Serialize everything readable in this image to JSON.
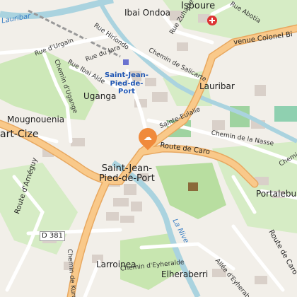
{
  "map": {
    "places": {
      "ibai_ondoa": "Ibai Ondoa",
      "ispoure": "Ispoure",
      "uganga": "Uganga",
      "lauribar": "Lauribar",
      "mougnouenia": "Mougnouenia",
      "art_cize": "art-Cize",
      "saint_jean_big": "Saint-Jean-\nPied-de-Port",
      "saint_jean_blue": "Saint-Jean-\nPied-de-\nPort",
      "larroinea": "Larroinea",
      "elheraberri": "Elheraberri",
      "portaleburu": "Portaleburu",
      "lauribar_top": "Lauribar"
    },
    "roads": {
      "rue_zuharte": "Rue Zuharte",
      "rue_abotia": "Rue Abotia",
      "avenue_colonel": "venue Colonel Bi",
      "rue_hirigoko": "Rue Hiriondo",
      "rue_urgain": "Rue d'Urgain",
      "rue_jara": "Rue du Jara",
      "chemin_salicarte": "Chemin de Salicarte",
      "chemin_ugange": "Chemin d'Ugange",
      "rue_ibai_alde": "Rue Ibai Alde",
      "sainte_eulalie": "Sainte-Eulalie",
      "chemin_nasse": "Chemin de la Nasse",
      "route_caro": "Route de Caro",
      "route_caro_2": "Route de Caro",
      "route_arneguy": "Route d'Arnéguy",
      "d381": "D 381",
      "chemin_eyheralde": "Chemin d'Eyheralde",
      "allee_eyheraberri": "Allée d'Eyheraberri",
      "chemin_kuroa": "Chemin de Kuroa",
      "chemin_ch": "Chemi"
    },
    "rivers": {
      "la_nive": "La Nive",
      "laurhibar": "Laurhibar"
    },
    "marker_icon": "map-pin-icon",
    "colors": {
      "land": "#f2efe9",
      "green": "#c8e6b0",
      "park": "#b8dea0",
      "water": "#aad3df",
      "major_road": "#f9c98a",
      "road": "#ffffff",
      "building": "#d9d0c9",
      "marker": "#f08a3b",
      "rail": "#999999"
    }
  }
}
